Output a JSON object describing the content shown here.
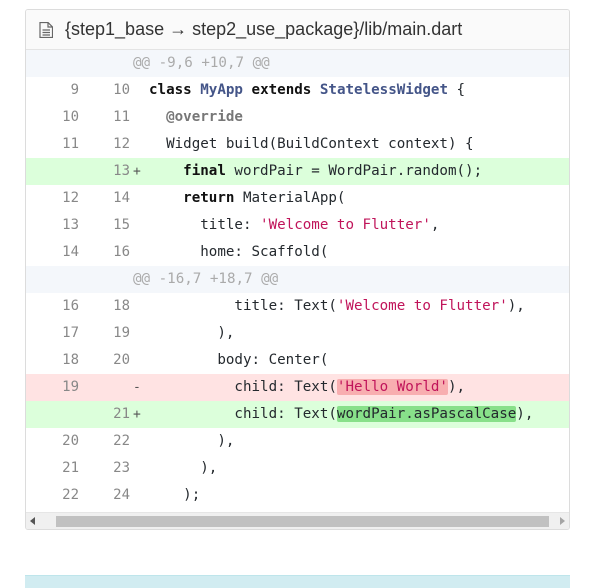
{
  "file_header": {
    "path": "{step1_base → step2_use_package}/lib/main.dart",
    "icon": "document-icon"
  },
  "diff_rows": [
    {
      "type": "hunk",
      "text": "@@ -9,6 +10,7 @@"
    },
    {
      "type": "context",
      "old": "9",
      "new": "10",
      "segments": [
        {
          "t": "class",
          "c": "kw"
        },
        {
          "t": " "
        },
        {
          "t": "MyApp",
          "c": "cls"
        },
        {
          "t": " "
        },
        {
          "t": "extends",
          "c": "kw"
        },
        {
          "t": " "
        },
        {
          "t": "StatelessWidget",
          "c": "cls"
        },
        {
          "t": " {"
        }
      ]
    },
    {
      "type": "context",
      "old": "10",
      "new": "11",
      "segments": [
        {
          "t": "  "
        },
        {
          "t": "@override",
          "c": "ann"
        }
      ]
    },
    {
      "type": "context",
      "old": "11",
      "new": "12",
      "segments": [
        {
          "t": "  Widget build(BuildContext context) {"
        }
      ]
    },
    {
      "type": "add",
      "old": "",
      "new": "13",
      "mark": "+",
      "segments": [
        {
          "t": "    "
        },
        {
          "t": "final",
          "c": "kw"
        },
        {
          "t": " wordPair = WordPair.random();"
        }
      ]
    },
    {
      "type": "context",
      "old": "12",
      "new": "14",
      "segments": [
        {
          "t": "    "
        },
        {
          "t": "return",
          "c": "kw"
        },
        {
          "t": " MaterialApp("
        }
      ]
    },
    {
      "type": "context",
      "old": "13",
      "new": "15",
      "segments": [
        {
          "t": "      title: "
        },
        {
          "t": "'Welcome to Flutter'",
          "c": "str"
        },
        {
          "t": ","
        }
      ]
    },
    {
      "type": "context",
      "old": "14",
      "new": "16",
      "segments": [
        {
          "t": "      home: Scaffold("
        }
      ]
    },
    {
      "type": "hunk",
      "text": "@@ -16,7 +18,7 @@"
    },
    {
      "type": "context",
      "old": "16",
      "new": "18",
      "segments": [
        {
          "t": "          title: Text("
        },
        {
          "t": "'Welcome to Flutter'",
          "c": "str"
        },
        {
          "t": "),"
        }
      ]
    },
    {
      "type": "context",
      "old": "17",
      "new": "19",
      "segments": [
        {
          "t": "        ),"
        }
      ]
    },
    {
      "type": "context",
      "old": "18",
      "new": "20",
      "segments": [
        {
          "t": "        body: Center("
        }
      ]
    },
    {
      "type": "del",
      "old": "19",
      "new": "",
      "mark": "-",
      "segments": [
        {
          "t": "          child: Text("
        },
        {
          "t": "'Hello World'",
          "c": "str hl-del"
        },
        {
          "t": "),"
        }
      ]
    },
    {
      "type": "add",
      "old": "",
      "new": "21",
      "mark": "+",
      "segments": [
        {
          "t": "          child: Text("
        },
        {
          "t": "wordPair.asPascalCase",
          "c": "hl-add"
        },
        {
          "t": "),"
        }
      ]
    },
    {
      "type": "context",
      "old": "20",
      "new": "22",
      "segments": [
        {
          "t": "        ),"
        }
      ]
    },
    {
      "type": "context",
      "old": "21",
      "new": "23",
      "segments": [
        {
          "t": "      ),"
        }
      ]
    },
    {
      "type": "context",
      "old": "22",
      "new": "24",
      "segments": [
        {
          "t": "    );"
        }
      ]
    }
  ],
  "scrollbar": {
    "left_arrow": "scroll-left-arrow-icon",
    "right_arrow": "scroll-right-arrow-icon"
  }
}
